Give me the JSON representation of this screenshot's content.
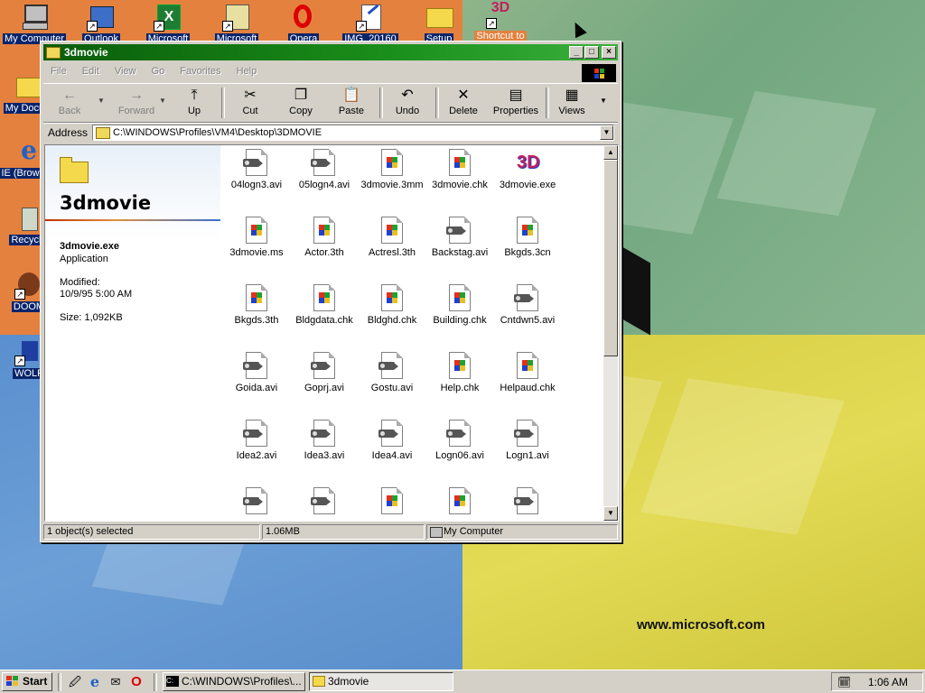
{
  "desktop": {
    "brand_text": "www.microsoft.com",
    "icons": [
      {
        "label": "My Computer",
        "icon": "computer-icon"
      },
      {
        "label": "Outlook",
        "icon": "outlook-icon"
      },
      {
        "label": "Microsoft",
        "icon": "excel-icon"
      },
      {
        "label": "Microsoft",
        "icon": "project-icon"
      },
      {
        "label": "Opera",
        "icon": "opera-icon"
      },
      {
        "label": "IMG_20160",
        "icon": "image-file-icon"
      },
      {
        "label": "Setup",
        "icon": "folder-icon"
      },
      {
        "label": "Shortcut to",
        "icon": "3d-shortcut-icon"
      },
      {
        "label": "My Docum",
        "icon": "folder-icon"
      },
      {
        "label": "IE (Browser)",
        "icon": "ie-icon"
      },
      {
        "label": "Recycle",
        "icon": "recycle-bin-icon"
      },
      {
        "label": "DOOM",
        "icon": "doom-icon"
      },
      {
        "label": "WOLF",
        "icon": "wolf3d-icon"
      }
    ]
  },
  "window": {
    "title": "3dmovie",
    "buttons": {
      "minimize": "_",
      "maximize": "□",
      "close": "×"
    },
    "menu": [
      "File",
      "Edit",
      "View",
      "Go",
      "Favorites",
      "Help"
    ],
    "toolbar": [
      {
        "label": "Back",
        "icon": "←",
        "enabled": false
      },
      {
        "label": "Forward",
        "icon": "→",
        "enabled": false
      },
      {
        "label": "Up",
        "icon": "⤒",
        "enabled": true
      },
      {
        "label": "Cut",
        "icon": "✂",
        "enabled": true
      },
      {
        "label": "Copy",
        "icon": "❐",
        "enabled": true
      },
      {
        "label": "Paste",
        "icon": "📋",
        "enabled": true
      },
      {
        "label": "Undo",
        "icon": "↶",
        "enabled": true
      },
      {
        "label": "Delete",
        "icon": "✕",
        "enabled": true
      },
      {
        "label": "Properties",
        "icon": "▤",
        "enabled": true
      },
      {
        "label": "Views",
        "icon": "▦",
        "enabled": true
      }
    ],
    "address": {
      "label": "Address",
      "value": "C:\\WINDOWS\\Profiles\\VM4\\Desktop\\3DMOVIE"
    },
    "sidebar": {
      "folder_name": "3dmovie",
      "selected_name": "3dmovie.exe",
      "selected_type": "Application",
      "modified_label": "Modified:",
      "modified_value": "10/9/95 5:00 AM",
      "size_text": "Size: 1,092KB"
    },
    "files": [
      {
        "name": "04logn3.avi",
        "kind": "video"
      },
      {
        "name": "05logn4.avi",
        "kind": "video"
      },
      {
        "name": "3dmovie.3mm",
        "kind": "win"
      },
      {
        "name": "3dmovie.chk",
        "kind": "win"
      },
      {
        "name": "3dmovie.exe",
        "kind": "exe"
      },
      {
        "name": "3dmovie.ms",
        "kind": "win"
      },
      {
        "name": "Actor.3th",
        "kind": "win"
      },
      {
        "name": "Actresl.3th",
        "kind": "win"
      },
      {
        "name": "Backstag.avi",
        "kind": "video"
      },
      {
        "name": "Bkgds.3cn",
        "kind": "win"
      },
      {
        "name": "Bkgds.3th",
        "kind": "win"
      },
      {
        "name": "Bldgdata.chk",
        "kind": "win"
      },
      {
        "name": "Bldghd.chk",
        "kind": "win"
      },
      {
        "name": "Building.chk",
        "kind": "win"
      },
      {
        "name": "Cntdwn5.avi",
        "kind": "video"
      },
      {
        "name": "Goida.avi",
        "kind": "video"
      },
      {
        "name": "Goprj.avi",
        "kind": "video"
      },
      {
        "name": "Gostu.avi",
        "kind": "video"
      },
      {
        "name": "Help.chk",
        "kind": "win"
      },
      {
        "name": "Helpaud.chk",
        "kind": "win"
      },
      {
        "name": "Idea2.avi",
        "kind": "video"
      },
      {
        "name": "Idea3.avi",
        "kind": "video"
      },
      {
        "name": "Idea4.avi",
        "kind": "video"
      },
      {
        "name": "Logn06.avi",
        "kind": "video"
      },
      {
        "name": "Logn1.avi",
        "kind": "video"
      },
      {
        "name": "",
        "kind": "video"
      },
      {
        "name": "",
        "kind": "video"
      },
      {
        "name": "",
        "kind": "win"
      },
      {
        "name": "",
        "kind": "win"
      },
      {
        "name": "",
        "kind": "video"
      }
    ],
    "status": {
      "selection": "1 object(s) selected",
      "size": "1.06MB",
      "zone": "My Computer"
    }
  },
  "taskbar": {
    "start_label": "Start",
    "quick_launch": [
      "desktop-icon",
      "ie-icon",
      "outlook-icon",
      "opera-icon"
    ],
    "tasks": [
      {
        "label": "C:\\WINDOWS\\Profiles\\...",
        "active": false
      },
      {
        "label": "3dmovie",
        "active": true
      }
    ],
    "clock": "1:06 AM"
  },
  "colors": {
    "title_bar": "#1a8e1a",
    "selection": "#0a246a"
  }
}
